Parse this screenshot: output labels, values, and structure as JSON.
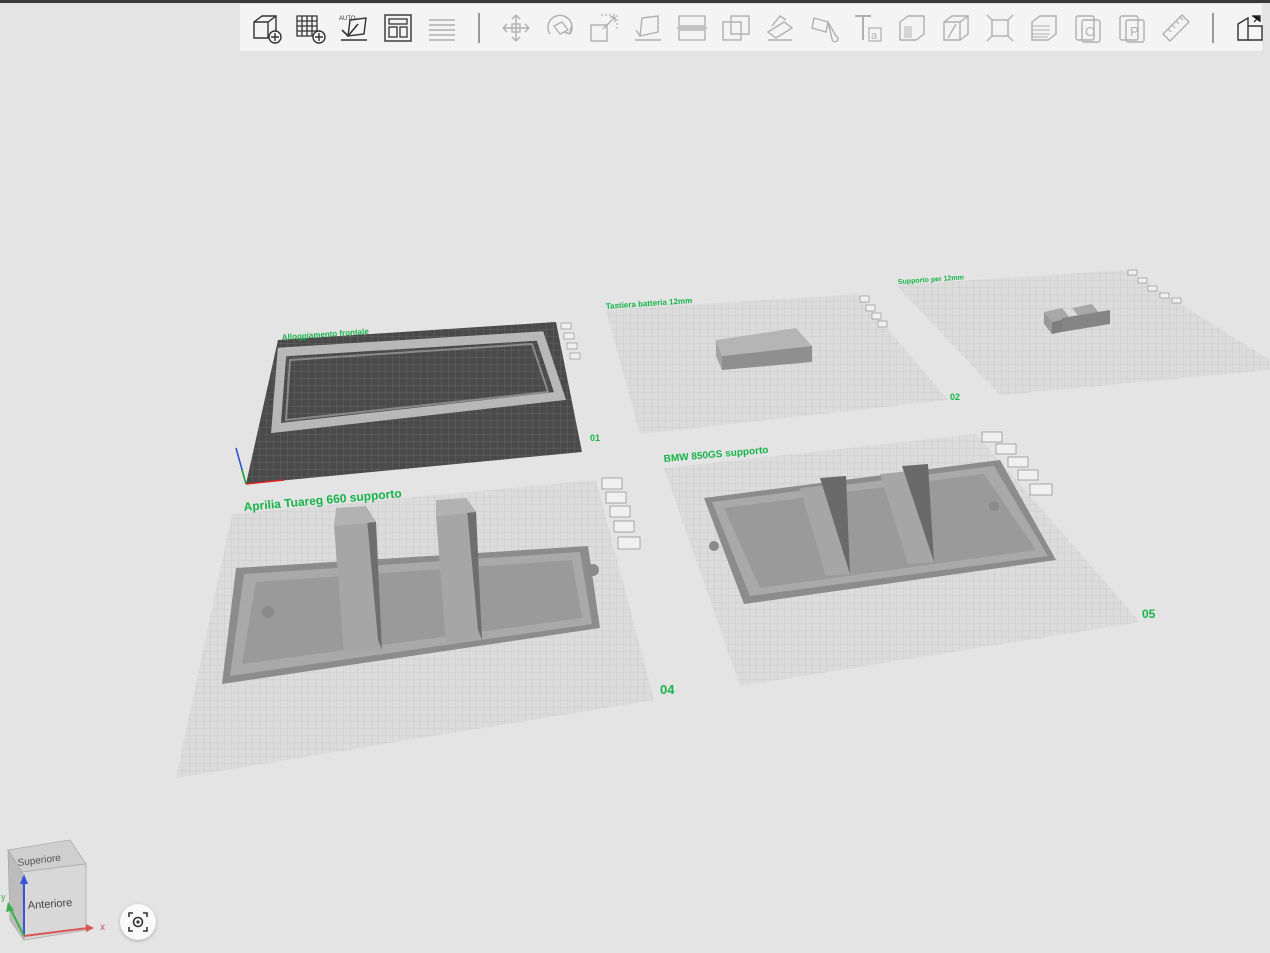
{
  "toolbar": {
    "groups": [
      [
        "add-object",
        "add-plate",
        "auto-orient",
        "arrange",
        "layers"
      ],
      [
        "move",
        "rotate",
        "scale",
        "place-on-face",
        "cut",
        "boolean",
        "support-paint",
        "seam-paint",
        "text",
        "emboss",
        "split-objects",
        "split-parts",
        "variable-layer-height",
        "assembly",
        "part",
        "measure"
      ],
      [
        "assembly-view"
      ]
    ]
  },
  "plates": [
    {
      "id": "plate-01",
      "label": "Alloggiamento frontale",
      "number": "01"
    },
    {
      "id": "plate-02",
      "label": "Tastiera batteria 12mm",
      "number": "02"
    },
    {
      "id": "plate-03",
      "label": "Supporto per 12mm",
      "number": ""
    },
    {
      "id": "plate-04",
      "label": "Aprilia Tuareg 660 supporto",
      "number": "04"
    },
    {
      "id": "plate-05",
      "label": "BMW 850GS supporto",
      "number": "05"
    }
  ],
  "navcube": {
    "top_label": "Superiore",
    "front_label": "Anteriore",
    "axis_x": "x",
    "axis_y": "y",
    "axis_z": "z"
  },
  "colors": {
    "accent": "#16b34a",
    "plate": "#d9d9d9",
    "active_plate": "#4a4a4a",
    "model": "#9a9a9a"
  }
}
